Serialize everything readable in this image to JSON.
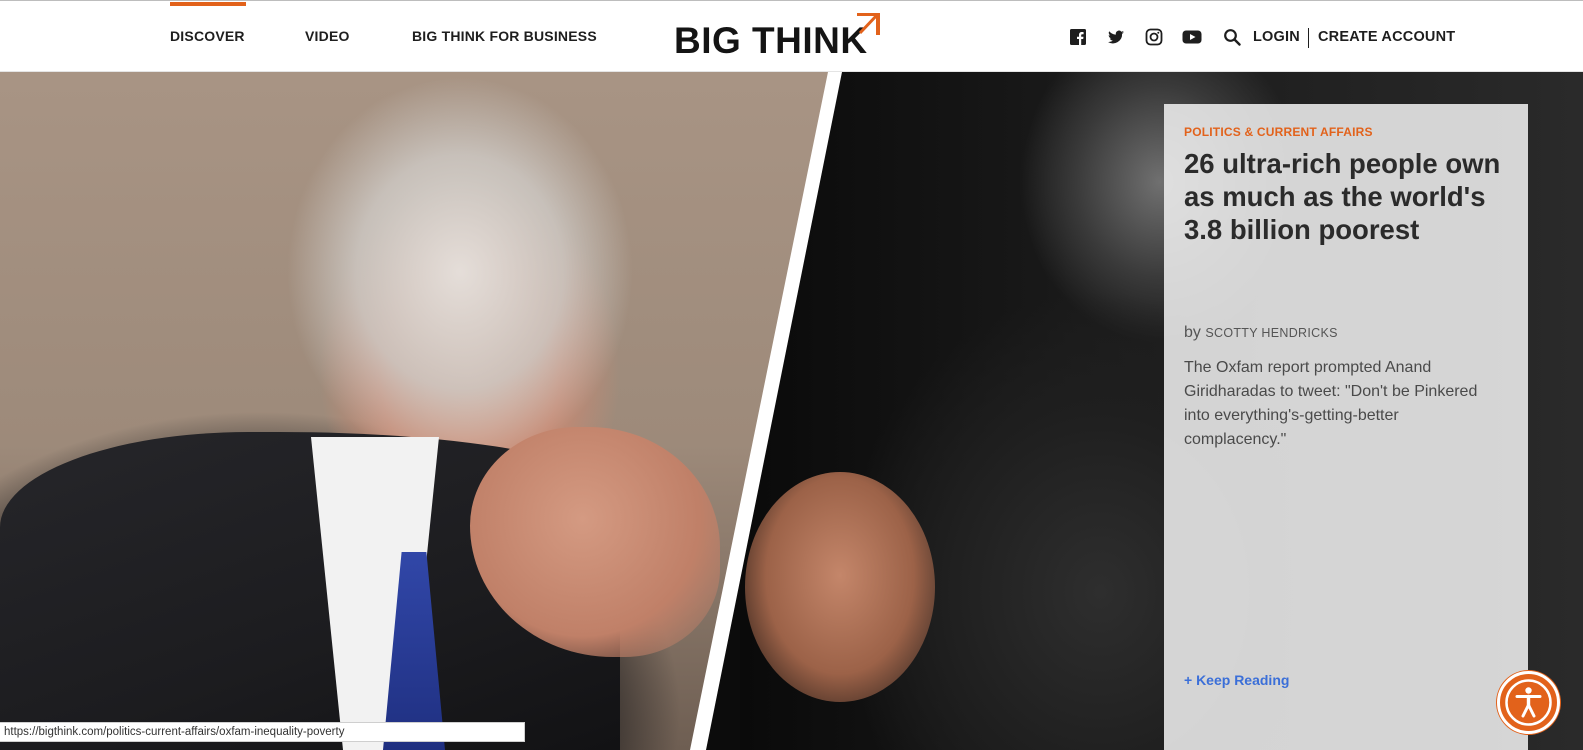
{
  "header": {
    "nav": [
      {
        "label": "DISCOVER",
        "active": true
      },
      {
        "label": "VIDEO",
        "active": false
      },
      {
        "label": "BIG THINK FOR BUSINESS",
        "active": false
      }
    ],
    "logo_text": "BIG THINK",
    "social_icons": [
      "facebook-icon",
      "twitter-icon",
      "instagram-icon",
      "youtube-icon"
    ],
    "login_label": "LOGIN",
    "create_account_label": "CREATE ACCOUNT"
  },
  "article": {
    "category": "POLITICS & CURRENT AFFAIRS",
    "title": "26 ultra-rich people own as much as the world's 3.8 billion poorest",
    "by": "by",
    "author": "SCOTTY HENDRICKS",
    "excerpt": "The Oxfam report prompted Anand Giridharadas to tweet: \"Don't be Pinkered into everything's-getting-better complacency.\"",
    "more_label": "+ Keep Reading"
  },
  "status_bar": {
    "url": "https://bigthink.com/politics-current-affairs/oxfam-inequality-poverty"
  },
  "colors": {
    "accent": "#e2621b",
    "link": "#3b6fd8",
    "text_dark": "#1e1e1e"
  }
}
